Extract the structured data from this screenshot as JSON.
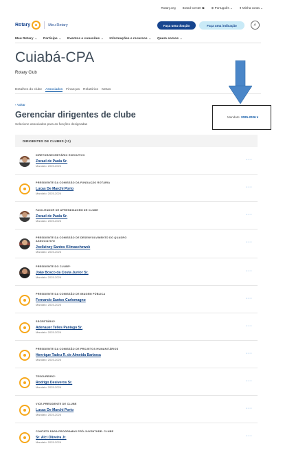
{
  "utility": {
    "links": [
      "Rotary.org",
      "Brand Center",
      "Português",
      "Minha conta"
    ]
  },
  "header": {
    "logo_word": "Rotary",
    "my_rotary": "Meu Rotary",
    "donate_label": "Faça uma doação",
    "indicate_label": "Faça uma indicação"
  },
  "nav": {
    "items": [
      "Meu Rotary",
      "Participe",
      "Eventos e conexões",
      "Informações e recursos",
      "Quem somos"
    ]
  },
  "club": {
    "name": "Cuiabá-CPA",
    "type": "Rotary Club"
  },
  "tabs": [
    "Detalhes do clube",
    "Associados",
    "Finanças",
    "Relatórios",
    "Metas"
  ],
  "active_tab": "Associados",
  "manage": {
    "back": "Voltar",
    "title": "Gerenciar dirigentes de clube",
    "subtitle": "Selecione associados para as funções designadas",
    "mandate_label": "Mandato:",
    "mandate_value": "2025-2026 ▾"
  },
  "list": {
    "header": "DIRIGENTES DE CLUBES (11)",
    "rows": [
      {
        "role": "Diretor/secretário executivo",
        "name": "Zozael de Paula Sr.",
        "term": "Mandato: 2025-2026"
      },
      {
        "role": "Presidente da Comissão da Fundação Rotária",
        "name": "Lucas De Marchi Porto",
        "term": "Mandato: 2025-2026"
      },
      {
        "role": "Facilitador de aprendizagem de clube",
        "name": "Zozael de Paula Sr.",
        "term": "Mandato: 2025-2026"
      },
      {
        "role": "Presidente da Comissão de Desenvolvimento do Quadro Associativo",
        "name": "Joeliziney Santos Klimaschewsk",
        "term": "Mandato: 2025-2026"
      },
      {
        "role": "Presidente do clube*",
        "name": "João Bosco da Costa Junior Sr.",
        "term": "Mandato: 2025-2026"
      },
      {
        "role": "Presidente da Comissão de Imagem Pública",
        "name": "Fernando Santos Carlomagno",
        "term": "Mandato: 2025-2026"
      },
      {
        "role": "Secretário*",
        "name": "Adenauer Telles Paniago Sr.",
        "term": "Mandato: 2025-2026"
      },
      {
        "role": "Presidente da Comissão de Projetos Humanitários",
        "name": "Henrique Tadeu R. de Almeida Barbosa",
        "term": "Mandato: 2025-2026"
      },
      {
        "role": "Tesoureiro*",
        "name": "Rodrigo Desiveros Sr.",
        "term": "Mandato: 2025-2026"
      },
      {
        "role": "Vice-presidente de clube",
        "name": "Lucas De Marchi Porto",
        "term": "Mandato: 2025-2026"
      },
      {
        "role": "Contato para programas pró-juventude: clube",
        "name": "Sr. Alci Oliveira Jr.",
        "term": "Mandato: 2025-2026"
      }
    ],
    "more_label": "···"
  },
  "colors": {
    "rotary_blue": "#17458f",
    "rotary_gold": "#f7a81b",
    "link_blue": "#0050a2",
    "annotation_arrow": "#4a86c8"
  }
}
